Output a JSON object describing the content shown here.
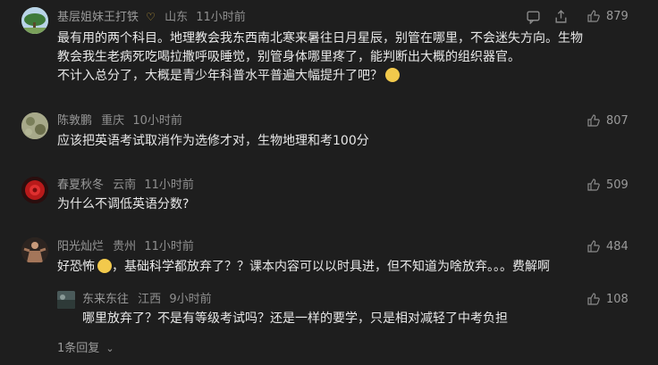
{
  "comments": [
    {
      "username": "基层姐妹王打铁",
      "location": "山东",
      "time": "11小时前",
      "likes": "879",
      "lines": [
        "最有用的两个科目。地理教会我东西南北寒来暑往日月星辰，别管在哪里，不会迷失方向。生物",
        "教会我生老病死吃喝拉撒呼吸睡觉，别管身体哪里疼了，能判断出大概的组织器官。",
        "不计入总分了，大概是青少年科普水平普遍大幅提升了吧？"
      ]
    },
    {
      "username": "陈敦鹏",
      "location": "重庆",
      "time": "10小时前",
      "likes": "807",
      "lines": [
        "应该把英语考试取消作为选修才对，生物地理和考100分"
      ]
    },
    {
      "username": "春夏秋冬",
      "location": "云南",
      "time": "11小时前",
      "likes": "509",
      "lines": [
        "为什么不调低英语分数?"
      ]
    },
    {
      "username": "阳光灿烂",
      "location": "贵州",
      "time": "11小时前",
      "likes": "484",
      "lines_pre": "好恐怖",
      "lines_post": "，基础科学都放弃了？？课本内容可以以时具进，但不知道为啥放弃。。。费解啊"
    },
    {
      "username": "东来东往",
      "location": "江西",
      "time": "9小时前",
      "likes": "108",
      "lines": [
        "哪里放弃了？不是有等级考试吗？还是一样的要学，只是相对减轻了中考负担"
      ]
    }
  ],
  "replies_link": "1条回复",
  "colors": {
    "background": "#1e1e1e",
    "text": "#e8e8e8",
    "meta": "#8f8f8f",
    "badge": "#c9a13b"
  }
}
